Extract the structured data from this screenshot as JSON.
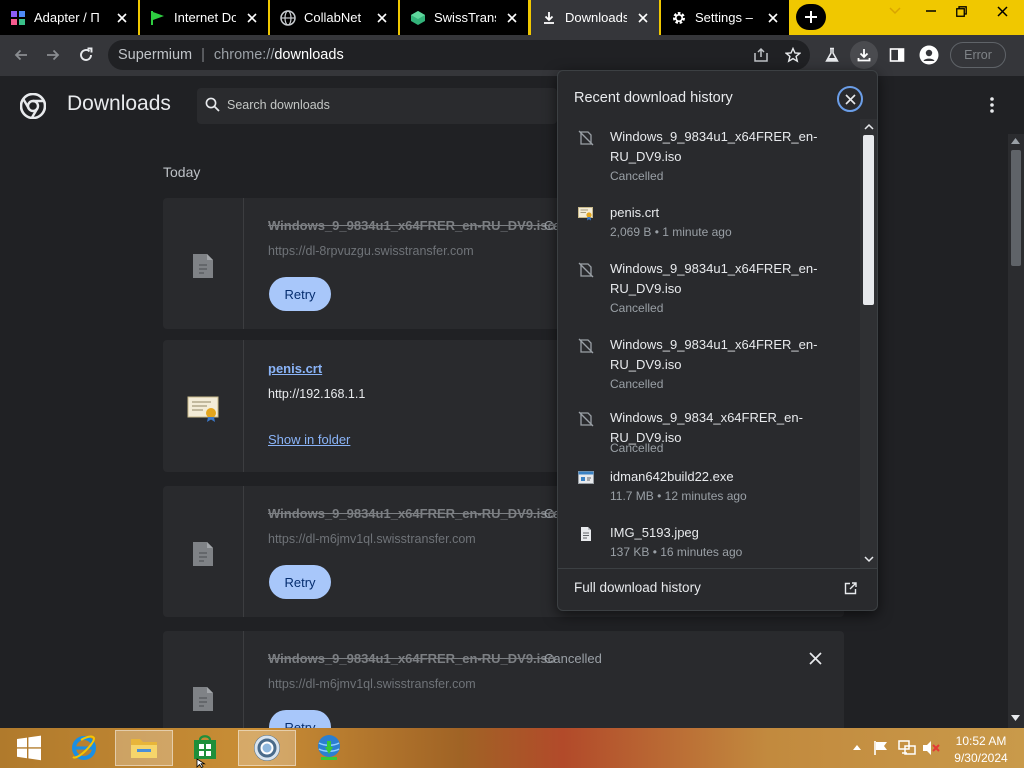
{
  "tabs": [
    {
      "title": "Adapter / П",
      "icon": "grid-app-icon"
    },
    {
      "title": "Internet Do",
      "icon": "green-flag-icon"
    },
    {
      "title": "CollabNet",
      "icon": "globe-icon"
    },
    {
      "title": "SwissTransf",
      "icon": "swisstransfer-icon"
    },
    {
      "title": "Downloads",
      "icon": "download-icon"
    },
    {
      "title": "Settings – S",
      "icon": "gear-icon"
    }
  ],
  "toolbar": {
    "omnibox_brand": "Supermium",
    "omnibox_separator": "|",
    "omnibox_scheme": "chrome://",
    "omnibox_path": "downloads",
    "error_label": "Error"
  },
  "page": {
    "title": "Downloads",
    "search_placeholder": "Search downloads",
    "day_label": "Today"
  },
  "downloads": [
    {
      "name": "Windows_9_9834u1_x64FRER_en-RU_DV9.iso",
      "status": "Cancelled",
      "url": "https://dl-8rpvuzgu.swisstransfer.com",
      "action": "Retry"
    },
    {
      "name": "penis.crt",
      "url": "http://192.168.1.1",
      "action": "Show in folder"
    },
    {
      "name": "Windows_9_9834u1_x64FRER_en-RU_DV9.iso",
      "status": "Cancelled",
      "url": "https://dl-m6jmv1ql.swisstransfer.com",
      "action": "Retry"
    },
    {
      "name": "Windows_9_9834u1_x64FRER_en-RU_DV9.iso",
      "status": "Cancelled",
      "url": "https://dl-m6jmv1ql.swisstransfer.com",
      "action": "Retry"
    }
  ],
  "popup": {
    "title": "Recent download history",
    "items": [
      {
        "name": "Windows_9_9834u1_x64FRER_en-RU_DV9.iso",
        "sub": "Cancelled",
        "icon": "cancelled-file-icon"
      },
      {
        "name": "penis.crt",
        "sub": "2,069 B • 1 minute ago",
        "icon": "certificate-icon"
      },
      {
        "name": "Windows_9_9834u1_x64FRER_en-RU_DV9.iso",
        "sub": "Cancelled",
        "icon": "cancelled-file-icon"
      },
      {
        "name": "Windows_9_9834u1_x64FRER_en-RU_DV9.iso",
        "sub": "Cancelled",
        "icon": "cancelled-file-icon"
      },
      {
        "name": "Windows_9_9834_x64FRER_en-RU_DV9.iso",
        "sub": "Cancelled",
        "icon": "cancelled-file-icon"
      },
      {
        "name": "idman642build22.exe",
        "sub": "11.7 MB • 12 minutes ago",
        "icon": "exe-file-icon"
      },
      {
        "name": "IMG_5193.jpeg",
        "sub": "137 KB • 16 minutes ago",
        "icon": "document-file-icon"
      }
    ],
    "footer": "Full download history"
  },
  "taskbar": {
    "time": "10:52 AM",
    "date": "9/30/2024"
  },
  "colors": {
    "accent_blue": "#8ab4f8",
    "retry_bg": "#a8c7fa",
    "tabstrip_yellow": "#f0c800",
    "background": "#202124"
  }
}
